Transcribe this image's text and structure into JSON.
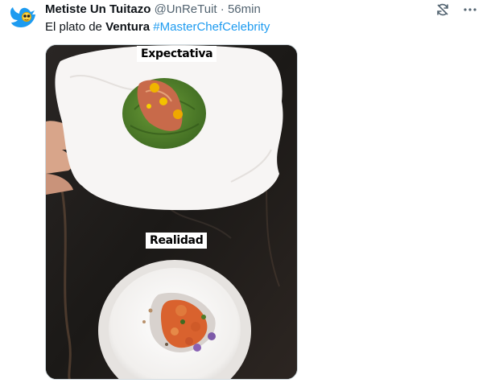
{
  "tweet": {
    "display_name": "Metiste Un Tuitazo",
    "handle": "@UnReTuit",
    "separator": "·",
    "time": "56min",
    "text_prefix": "El plato de ",
    "text_bold": "Ventura",
    "text_space": " ",
    "hashtag": "#MasterChefCelebrity"
  },
  "media": {
    "label_top": "Expectativa",
    "label_bottom": "Realidad"
  },
  "icons": {
    "avatar": "bird-avatar-icon",
    "retweet_off": "no-sync-icon",
    "more": "more-dots-icon"
  },
  "colors": {
    "text": "#0f1419",
    "secondary": "#536471",
    "link": "#1d9bf0",
    "avatar": "#1d9bf0"
  }
}
